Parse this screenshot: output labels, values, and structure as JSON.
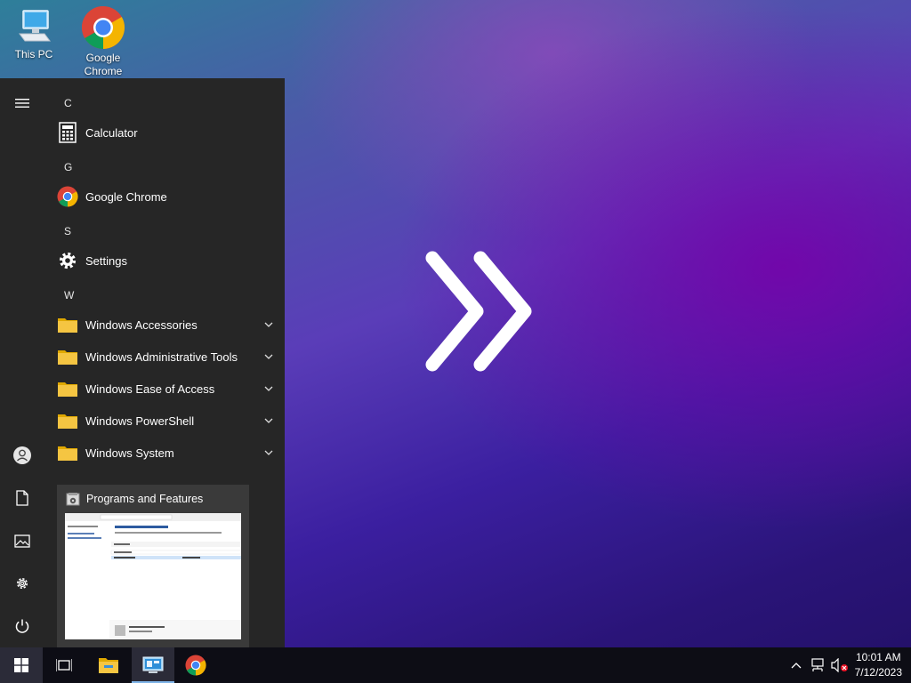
{
  "desktop": {
    "icons": [
      {
        "label": "This PC",
        "icon": "computer-icon"
      },
      {
        "label": "Google Chrome",
        "icon": "chrome-icon"
      }
    ],
    "hero_icon": "double-chevron-right-icon"
  },
  "start_menu": {
    "rail": [
      {
        "name": "hamburger-icon"
      },
      {
        "name": "user-account-icon"
      },
      {
        "name": "documents-icon"
      },
      {
        "name": "pictures-icon"
      },
      {
        "name": "settings-gear-icon"
      },
      {
        "name": "power-icon"
      }
    ],
    "groups": [
      {
        "letter": "C",
        "apps": [
          {
            "label": "Calculator",
            "icon": "calculator-icon"
          }
        ]
      },
      {
        "letter": "G",
        "apps": [
          {
            "label": "Google Chrome",
            "icon": "chrome-icon"
          }
        ]
      },
      {
        "letter": "S",
        "apps": [
          {
            "label": "Settings",
            "icon": "gear-icon"
          }
        ]
      },
      {
        "letter": "W",
        "apps": [
          {
            "label": "Windows Accessories",
            "icon": "folder-icon",
            "expandable": true
          },
          {
            "label": "Windows Administrative Tools",
            "icon": "folder-icon",
            "expandable": true
          },
          {
            "label": "Windows Ease of Access",
            "icon": "folder-icon",
            "expandable": true
          },
          {
            "label": "Windows PowerShell",
            "icon": "folder-icon",
            "expandable": true
          },
          {
            "label": "Windows System",
            "icon": "folder-icon",
            "expandable": true
          }
        ]
      }
    ]
  },
  "preview": {
    "title": "Programs and Features",
    "icon": "programs-features-icon"
  },
  "taskbar": {
    "items": [
      {
        "name": "start-button",
        "icon": "windows-logo-icon"
      },
      {
        "name": "task-view-button",
        "icon": "task-view-icon"
      },
      {
        "name": "file-explorer-button",
        "icon": "folder-icon"
      },
      {
        "name": "control-panel-button",
        "icon": "control-panel-icon",
        "active": true
      },
      {
        "name": "chrome-taskbar-button",
        "icon": "chrome-icon"
      }
    ],
    "tray": {
      "time": "10:01 AM",
      "date": "7/12/2023"
    }
  },
  "colors": {
    "start_bg": "#262626",
    "taskbar_bg": "#0d0d15",
    "folder": "#f5c542",
    "accent": "#7fb4e8"
  }
}
